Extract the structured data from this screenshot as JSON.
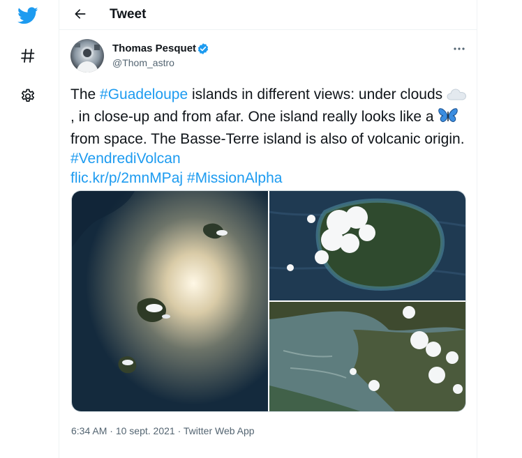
{
  "header": {
    "title": "Tweet"
  },
  "tweet": {
    "author_name": "Thomas Pesquet",
    "author_handle": "@Thom_astro",
    "text": {
      "t1": "The ",
      "h1": "#Guadeloupe",
      "t2": " islands in different views: under clouds ",
      "t3": ", in close-up and from afar. One island really looks like a ",
      "t4": " from space. The Basse-Terre island is also of volcanic origin. ",
      "h2": "#VendrediVolcan",
      "link": "flic.kr/p/2mnMPaj",
      "h3": "#MissionAlpha"
    },
    "emojis": [
      "cloud-emoji",
      "butterfly-emoji"
    ],
    "time": "6:34 AM",
    "date": "10 sept. 2021",
    "source": "Twitter Web App",
    "separator": "·"
  },
  "colors": {
    "accent": "#1d9bf0",
    "text": "#0f1419",
    "muted": "#536471",
    "border": "#eff3f4"
  },
  "icons": [
    "twitter-logo-icon",
    "hashtag-icon",
    "gear-icon",
    "back-arrow-icon",
    "verified-icon",
    "more-icon"
  ]
}
